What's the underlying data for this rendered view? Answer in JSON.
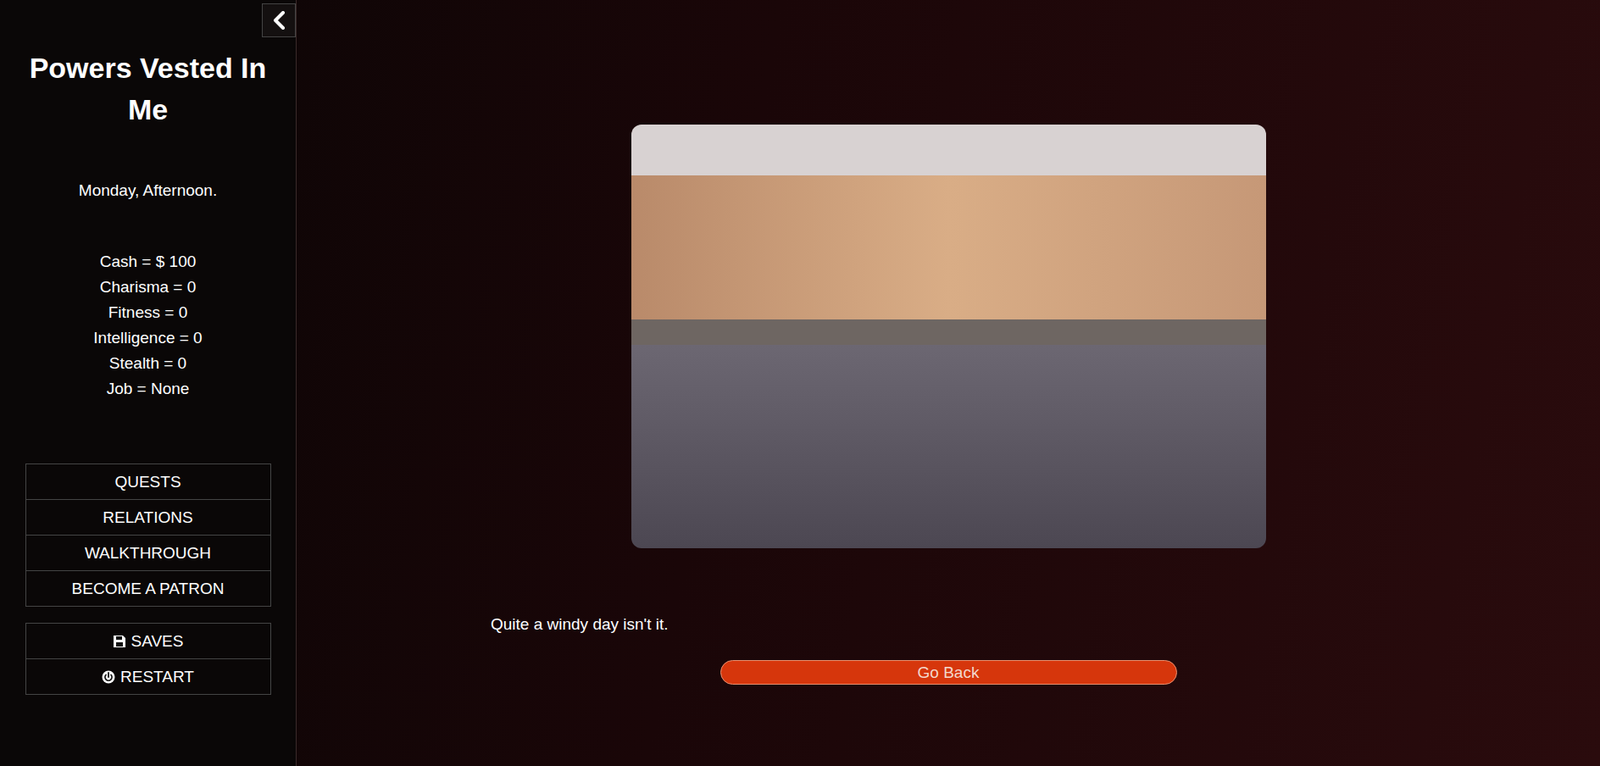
{
  "sidebar": {
    "title": "Powers Vested In Me",
    "time": "Monday, Afternoon.",
    "stats": [
      "Cash = $ 100",
      "Charisma = 0",
      "Fitness = 0",
      "Intelligence = 0",
      "Stealth = 0",
      "Job = None"
    ],
    "menu": [
      "QUESTS",
      "RELATIONS",
      "WALKTHROUGH",
      "BECOME A PATRON"
    ],
    "system": [
      {
        "label": "SAVES",
        "kind": "save"
      },
      {
        "label": "RESTART",
        "kind": "restart"
      }
    ]
  },
  "main": {
    "caption": "Quite a windy day isn't it.",
    "button": "Go Back"
  }
}
